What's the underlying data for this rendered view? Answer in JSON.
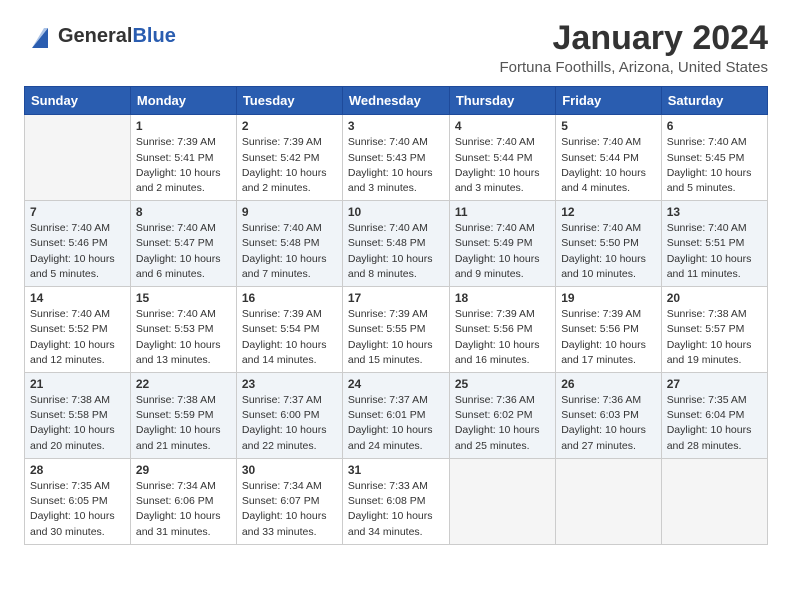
{
  "header": {
    "logo_general": "General",
    "logo_blue": "Blue",
    "month_title": "January 2024",
    "location": "Fortuna Foothills, Arizona, United States"
  },
  "days_of_week": [
    "Sunday",
    "Monday",
    "Tuesday",
    "Wednesday",
    "Thursday",
    "Friday",
    "Saturday"
  ],
  "weeks": [
    [
      {
        "num": "",
        "empty": true
      },
      {
        "num": "1",
        "sunrise": "Sunrise: 7:39 AM",
        "sunset": "Sunset: 5:41 PM",
        "daylight": "Daylight: 10 hours and 2 minutes."
      },
      {
        "num": "2",
        "sunrise": "Sunrise: 7:39 AM",
        "sunset": "Sunset: 5:42 PM",
        "daylight": "Daylight: 10 hours and 2 minutes."
      },
      {
        "num": "3",
        "sunrise": "Sunrise: 7:40 AM",
        "sunset": "Sunset: 5:43 PM",
        "daylight": "Daylight: 10 hours and 3 minutes."
      },
      {
        "num": "4",
        "sunrise": "Sunrise: 7:40 AM",
        "sunset": "Sunset: 5:44 PM",
        "daylight": "Daylight: 10 hours and 3 minutes."
      },
      {
        "num": "5",
        "sunrise": "Sunrise: 7:40 AM",
        "sunset": "Sunset: 5:44 PM",
        "daylight": "Daylight: 10 hours and 4 minutes."
      },
      {
        "num": "6",
        "sunrise": "Sunrise: 7:40 AM",
        "sunset": "Sunset: 5:45 PM",
        "daylight": "Daylight: 10 hours and 5 minutes."
      }
    ],
    [
      {
        "num": "7",
        "sunrise": "Sunrise: 7:40 AM",
        "sunset": "Sunset: 5:46 PM",
        "daylight": "Daylight: 10 hours and 5 minutes."
      },
      {
        "num": "8",
        "sunrise": "Sunrise: 7:40 AM",
        "sunset": "Sunset: 5:47 PM",
        "daylight": "Daylight: 10 hours and 6 minutes."
      },
      {
        "num": "9",
        "sunrise": "Sunrise: 7:40 AM",
        "sunset": "Sunset: 5:48 PM",
        "daylight": "Daylight: 10 hours and 7 minutes."
      },
      {
        "num": "10",
        "sunrise": "Sunrise: 7:40 AM",
        "sunset": "Sunset: 5:48 PM",
        "daylight": "Daylight: 10 hours and 8 minutes."
      },
      {
        "num": "11",
        "sunrise": "Sunrise: 7:40 AM",
        "sunset": "Sunset: 5:49 PM",
        "daylight": "Daylight: 10 hours and 9 minutes."
      },
      {
        "num": "12",
        "sunrise": "Sunrise: 7:40 AM",
        "sunset": "Sunset: 5:50 PM",
        "daylight": "Daylight: 10 hours and 10 minutes."
      },
      {
        "num": "13",
        "sunrise": "Sunrise: 7:40 AM",
        "sunset": "Sunset: 5:51 PM",
        "daylight": "Daylight: 10 hours and 11 minutes."
      }
    ],
    [
      {
        "num": "14",
        "sunrise": "Sunrise: 7:40 AM",
        "sunset": "Sunset: 5:52 PM",
        "daylight": "Daylight: 10 hours and 12 minutes."
      },
      {
        "num": "15",
        "sunrise": "Sunrise: 7:40 AM",
        "sunset": "Sunset: 5:53 PM",
        "daylight": "Daylight: 10 hours and 13 minutes."
      },
      {
        "num": "16",
        "sunrise": "Sunrise: 7:39 AM",
        "sunset": "Sunset: 5:54 PM",
        "daylight": "Daylight: 10 hours and 14 minutes."
      },
      {
        "num": "17",
        "sunrise": "Sunrise: 7:39 AM",
        "sunset": "Sunset: 5:55 PM",
        "daylight": "Daylight: 10 hours and 15 minutes."
      },
      {
        "num": "18",
        "sunrise": "Sunrise: 7:39 AM",
        "sunset": "Sunset: 5:56 PM",
        "daylight": "Daylight: 10 hours and 16 minutes."
      },
      {
        "num": "19",
        "sunrise": "Sunrise: 7:39 AM",
        "sunset": "Sunset: 5:56 PM",
        "daylight": "Daylight: 10 hours and 17 minutes."
      },
      {
        "num": "20",
        "sunrise": "Sunrise: 7:38 AM",
        "sunset": "Sunset: 5:57 PM",
        "daylight": "Daylight: 10 hours and 19 minutes."
      }
    ],
    [
      {
        "num": "21",
        "sunrise": "Sunrise: 7:38 AM",
        "sunset": "Sunset: 5:58 PM",
        "daylight": "Daylight: 10 hours and 20 minutes."
      },
      {
        "num": "22",
        "sunrise": "Sunrise: 7:38 AM",
        "sunset": "Sunset: 5:59 PM",
        "daylight": "Daylight: 10 hours and 21 minutes."
      },
      {
        "num": "23",
        "sunrise": "Sunrise: 7:37 AM",
        "sunset": "Sunset: 6:00 PM",
        "daylight": "Daylight: 10 hours and 22 minutes."
      },
      {
        "num": "24",
        "sunrise": "Sunrise: 7:37 AM",
        "sunset": "Sunset: 6:01 PM",
        "daylight": "Daylight: 10 hours and 24 minutes."
      },
      {
        "num": "25",
        "sunrise": "Sunrise: 7:36 AM",
        "sunset": "Sunset: 6:02 PM",
        "daylight": "Daylight: 10 hours and 25 minutes."
      },
      {
        "num": "26",
        "sunrise": "Sunrise: 7:36 AM",
        "sunset": "Sunset: 6:03 PM",
        "daylight": "Daylight: 10 hours and 27 minutes."
      },
      {
        "num": "27",
        "sunrise": "Sunrise: 7:35 AM",
        "sunset": "Sunset: 6:04 PM",
        "daylight": "Daylight: 10 hours and 28 minutes."
      }
    ],
    [
      {
        "num": "28",
        "sunrise": "Sunrise: 7:35 AM",
        "sunset": "Sunset: 6:05 PM",
        "daylight": "Daylight: 10 hours and 30 minutes."
      },
      {
        "num": "29",
        "sunrise": "Sunrise: 7:34 AM",
        "sunset": "Sunset: 6:06 PM",
        "daylight": "Daylight: 10 hours and 31 minutes."
      },
      {
        "num": "30",
        "sunrise": "Sunrise: 7:34 AM",
        "sunset": "Sunset: 6:07 PM",
        "daylight": "Daylight: 10 hours and 33 minutes."
      },
      {
        "num": "31",
        "sunrise": "Sunrise: 7:33 AM",
        "sunset": "Sunset: 6:08 PM",
        "daylight": "Daylight: 10 hours and 34 minutes."
      },
      {
        "num": "",
        "empty": true
      },
      {
        "num": "",
        "empty": true
      },
      {
        "num": "",
        "empty": true
      }
    ]
  ]
}
